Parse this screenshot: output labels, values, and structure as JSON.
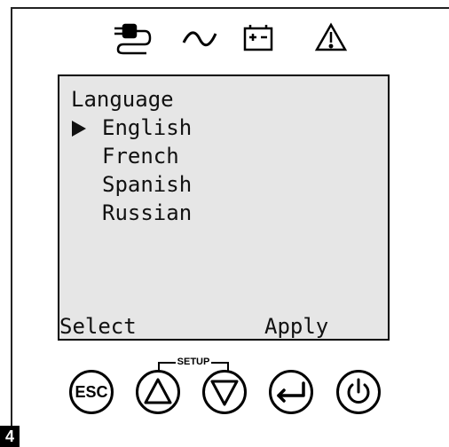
{
  "status_icons": [
    "ac-plug-icon",
    "sine-wave-icon",
    "battery-icon",
    "warning-icon"
  ],
  "lcd": {
    "title": "Language",
    "options": [
      {
        "label": "English",
        "selected": true
      },
      {
        "label": "French",
        "selected": false
      },
      {
        "label": "Spanish",
        "selected": false
      },
      {
        "label": "Russian",
        "selected": false
      }
    ],
    "softkey_left": "Select",
    "softkey_right": "Apply"
  },
  "controls": {
    "setup_label": "SETUP",
    "esc_label": "ESC",
    "buttons": [
      "esc-button",
      "up-button",
      "down-button",
      "enter-button",
      "power-button"
    ]
  },
  "step_number": "4"
}
